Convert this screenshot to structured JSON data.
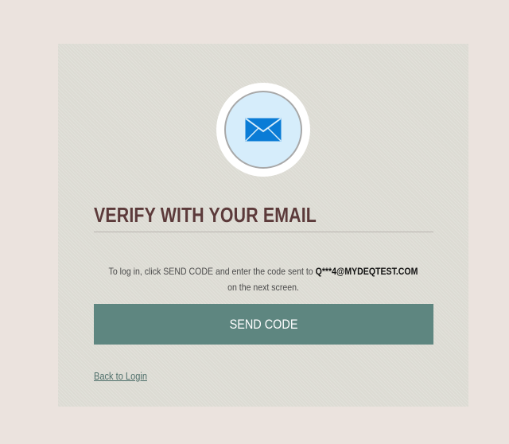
{
  "card": {
    "icon": "envelope-icon",
    "title": "VERIFY WITH YOUR EMAIL",
    "message_prefix": "To log in, click SEND CODE and enter the code sent to",
    "masked_email": "Q***4@MYDEQTEST.COM",
    "message_suffix": "on the next screen.",
    "send_button_label": "SEND CODE",
    "back_link_label": "Back to Login"
  },
  "colors": {
    "page_background": "#ebe3de",
    "card_background": "#dcdbd3",
    "title": "#5c3a3a",
    "button": "#5e8680",
    "icon_fill": "#0a7cd6"
  }
}
